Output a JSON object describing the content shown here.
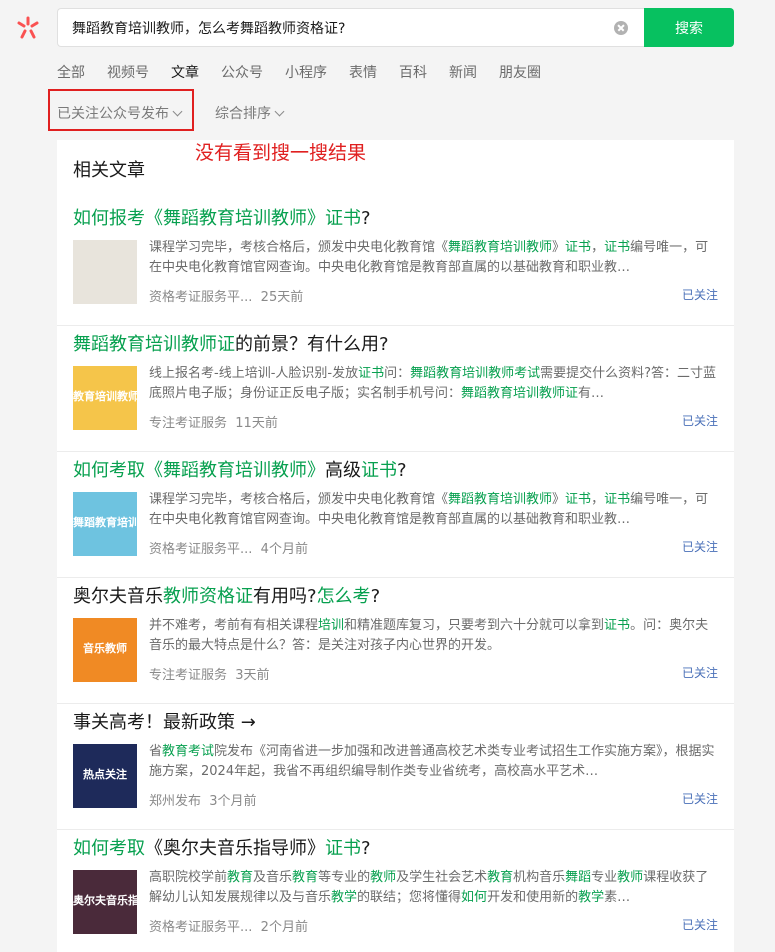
{
  "search": {
    "query": "舞蹈教育培训教师，怎么考舞蹈教师资格证?",
    "button_label": "搜索"
  },
  "tabs": [
    {
      "label": "全部",
      "active": false
    },
    {
      "label": "视频号",
      "active": false
    },
    {
      "label": "文章",
      "active": true
    },
    {
      "label": "公众号",
      "active": false
    },
    {
      "label": "小程序",
      "active": false
    },
    {
      "label": "表情",
      "active": false
    },
    {
      "label": "百科",
      "active": false
    },
    {
      "label": "新闻",
      "active": false
    },
    {
      "label": "朋友圈",
      "active": false
    }
  ],
  "filters": {
    "source": "已关注公众号发布",
    "sort": "综合排序"
  },
  "annotation": "没有看到搜一搜结果",
  "section_title": "相关文章",
  "colors": {
    "accent": "#07c160",
    "highlight": "#07a04f",
    "annotation": "#e02020",
    "followed": "#4a70b8"
  },
  "articles": [
    {
      "title_html": "<span class=\"hl\">如何报考《舞蹈教育培训教师》证书</span>?",
      "snippet_html": "课程学习完毕，考核合格后，颁发中央电化教育馆《<span class=\"hl\">舞蹈教育培训教师</span>》<span class=\"hl\">证书</span>，<span class=\"hl\">证书</span>编号唯一，可在中央电化教育馆官网查询。中央电化教育馆是教育部直属的以基础教育和职业教…",
      "source": "资格考证服务平...",
      "time": "25天前",
      "followed": "已关注",
      "thumb_text": "",
      "thumb_bg": "#e8e4dc"
    },
    {
      "title_html": "<span class=\"hl\">舞蹈教育培训教师证</span>的前景？有什么用?",
      "snippet_html": "线上报名考-线上培训-人脸识别-发放<span class=\"hl\">证书</span>问：<span class=\"hl\">舞蹈教育培训教师考试</span>需要提交什么资料?答：二寸蓝底照片电子版；身份证正反电子版；实名制手机号问：<span class=\"hl\">舞蹈教育培训教师证</span>有…",
      "source": "专注考证服务",
      "time": "11天前",
      "followed": "已关注",
      "thumb_text": "教育培训教师",
      "thumb_bg": "#f5c54a"
    },
    {
      "title_html": "<span class=\"hl\">如何考取《舞蹈教育培训教师》</span>高级<span class=\"hl\">证书</span>?",
      "snippet_html": "课程学习完毕，考核合格后，颁发中央电化教育馆《<span class=\"hl\">舞蹈教育培训教师</span>》<span class=\"hl\">证书</span>，<span class=\"hl\">证书</span>编号唯一，可在中央电化教育馆官网查询。中央电化教育馆是教育部直属的以基础教育和职业教…",
      "source": "资格考证服务平...",
      "time": "4个月前",
      "followed": "已关注",
      "thumb_text": "舞蹈教育培训教师",
      "thumb_bg": "#6ec3e0"
    },
    {
      "title_html": "奥尔夫音乐<span class=\"hl\">教师资格证</span>有用吗?<span class=\"hl\">怎么考</span>?",
      "snippet_html": "并不难考，考前有有相关课程<span class=\"hl\">培训</span>和精准题库复习，只要考到六十分就可以拿到<span class=\"hl\">证书</span>。问：奥尔夫音乐的最大特点是什么？答：是关注对孩子内心世界的开发。",
      "source": "专注考证服务",
      "time": "3天前",
      "followed": "已关注",
      "thumb_text": "音乐教师",
      "thumb_bg": "#f08a24"
    },
    {
      "title_html": "事关高考！最新政策 →",
      "snippet_html": "省<span class=\"hl\">教育考试</span>院发布《河南省进一步加强和改进普通高校艺术类专业考试招生工作实施方案》，根据实施方案，2024年起，我省不再组织编导制作类专业省统考，高校高水平艺术…",
      "source": "郑州发布",
      "time": "3个月前",
      "followed": "已关注",
      "thumb_text": "热点关注",
      "thumb_bg": "#1e2a5a"
    },
    {
      "title_html": "<span class=\"hl\">如何考取</span>《奥尔夫音乐指导师》<span class=\"hl\">证书</span>?",
      "snippet_html": "高职院校学前<span class=\"hl\">教育</span>及音乐<span class=\"hl\">教育</span>等专业的<span class=\"hl\">教师</span>及学生社会艺术<span class=\"hl\">教育</span>机构音乐<span class=\"hl\">舞蹈</span>专业<span class=\"hl\">教师</span>课程收获了解幼儿认知发展规律以及与音乐<span class=\"hl\">教学</span>的联结；您将懂得<span class=\"hl\">如何</span>开发和使用新的<span class=\"hl\">教学</span>素…",
      "source": "资格考证服务平...",
      "time": "2个月前",
      "followed": "已关注",
      "thumb_text": "奥尔夫音乐指导",
      "thumb_bg": "#4a2a3a"
    }
  ]
}
